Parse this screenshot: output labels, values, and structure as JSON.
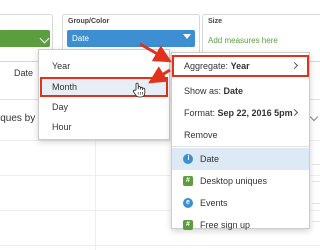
{
  "shelves": {
    "group_color": {
      "title": "Group/Color",
      "pill": "Date"
    },
    "size": {
      "title": "Size",
      "placeholder": "Add measures here"
    }
  },
  "background": {
    "date_tag": "Date",
    "chart_title_fragment": "iques by",
    "dots": "...."
  },
  "menu_left": {
    "items": [
      {
        "label": "Year"
      },
      {
        "label": "Month"
      },
      {
        "label": "Day"
      },
      {
        "label": "Hour"
      }
    ]
  },
  "menu_right": {
    "aggregate": {
      "prefix": "Aggregate:",
      "value": "Year"
    },
    "show_as": {
      "prefix": "Show as:",
      "value": "Date"
    },
    "format": {
      "prefix": "Format:",
      "value": "Sep 22, 2016 5pm"
    },
    "remove": "Remove",
    "properties": [
      {
        "label": "Date",
        "icon": "clock-icon"
      },
      {
        "label": "Desktop uniques",
        "icon": "number-icon"
      },
      {
        "label": "Events",
        "icon": "event-icon"
      },
      {
        "label": "Free sign up",
        "icon": "number-icon"
      }
    ]
  },
  "colors": {
    "green": "#5b9e3d",
    "blue": "#3d8fd1",
    "highlight": "#e0321c"
  }
}
